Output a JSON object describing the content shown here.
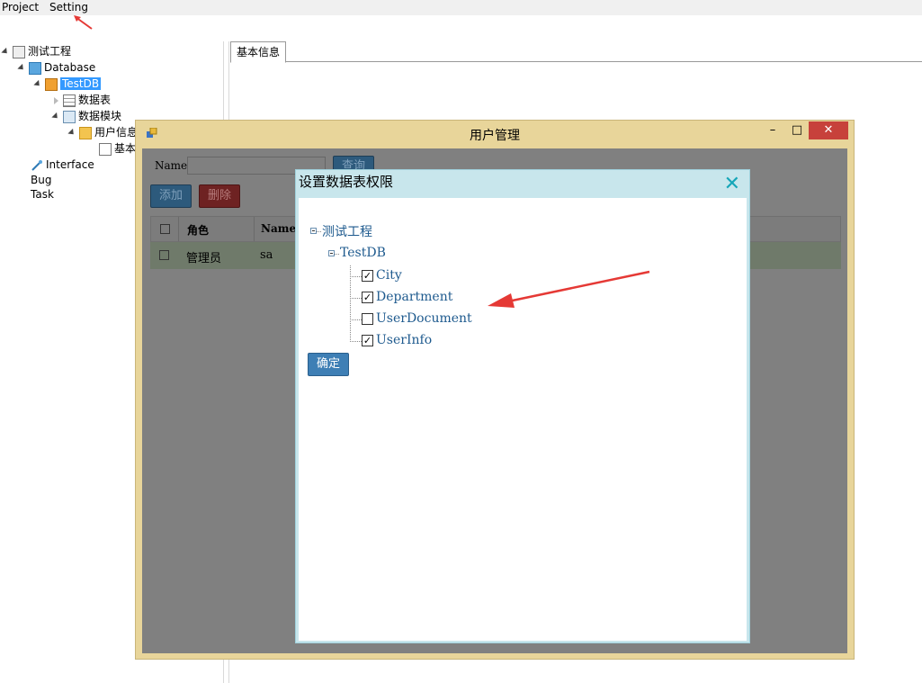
{
  "menu": {
    "project": "Project",
    "setting": "Setting"
  },
  "tree": {
    "root": "测试工程",
    "database": "Database",
    "testdb": "TestDB",
    "tables": "数据表",
    "modules": "数据模块",
    "userinfo": "用户信息",
    "basic": "基本",
    "interface": "Interface",
    "bug": "Bug",
    "task": "Task"
  },
  "main_tab": "基本信息",
  "window": {
    "title": "用户管理",
    "min": "–",
    "max": "□",
    "close": "✕",
    "name_label": "Name",
    "query": "查询",
    "add": "添加",
    "delete": "删除",
    "columns": [
      "角色",
      "Name"
    ],
    "rows": [
      {
        "role": "管理员",
        "name": "sa",
        "checked": false
      }
    ]
  },
  "dialog": {
    "title": "设置数据表权限",
    "close": "✕",
    "root": "测试工程",
    "db": "TestDB",
    "items": [
      {
        "label": "City",
        "checked": true
      },
      {
        "label": "Department",
        "checked": true
      },
      {
        "label": "UserDocument",
        "checked": false
      },
      {
        "label": "UserInfo",
        "checked": true
      }
    ],
    "ok": "确定"
  },
  "colors": {
    "window_frame": "#e8d59a",
    "dialog_header": "#c8e6ec",
    "link": "#1e5a8e",
    "annotation": "#e53935"
  }
}
